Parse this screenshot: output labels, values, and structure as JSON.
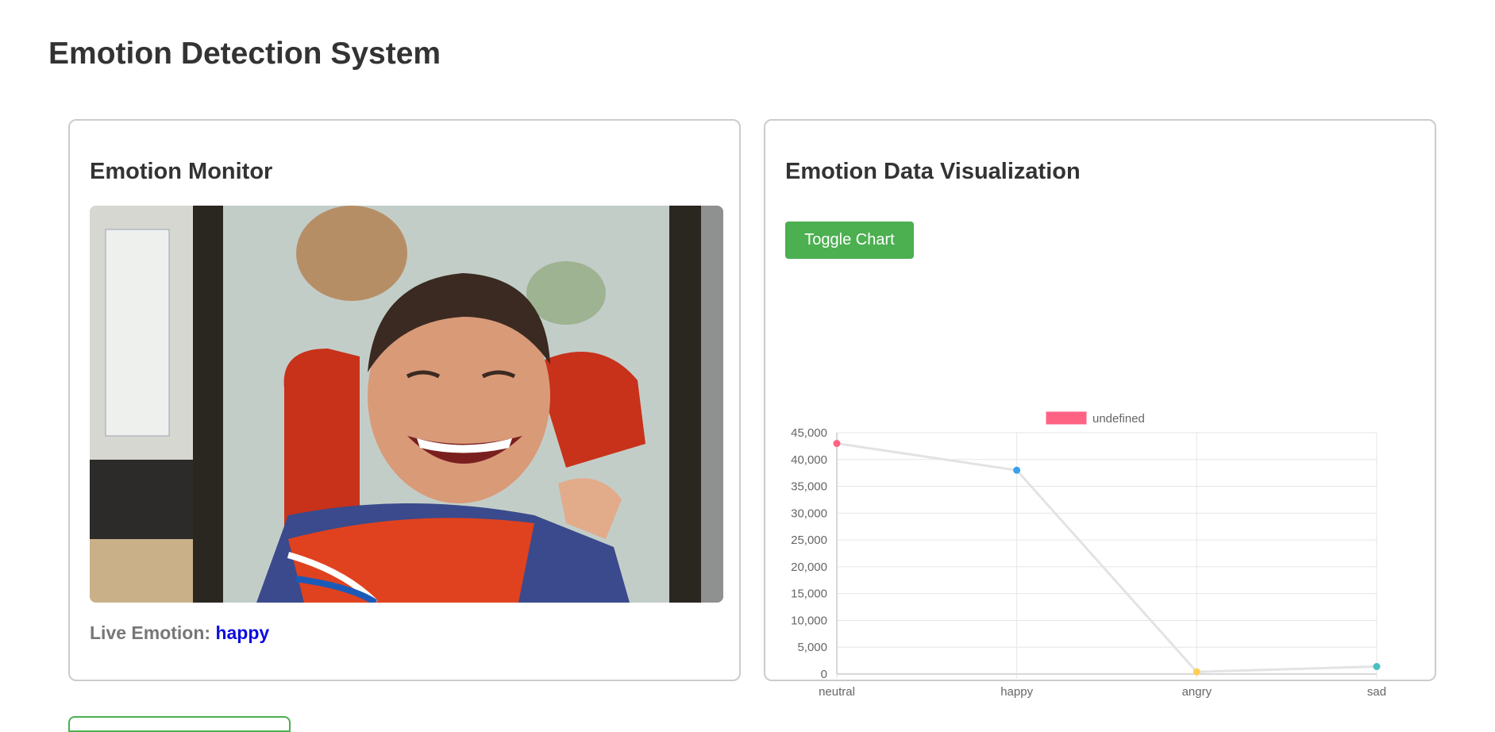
{
  "page": {
    "title": "Emotion Detection System"
  },
  "monitor": {
    "title": "Emotion Monitor",
    "live_label": "Live Emotion:",
    "live_value": "happy"
  },
  "visualization": {
    "title": "Emotion Data Visualization",
    "toggle_label": "Toggle Chart"
  },
  "colors": {
    "accent_green": "#4caf50",
    "live_value_blue": "#0b0be0",
    "legend_red": "#ff6384"
  },
  "chart_data": {
    "type": "line",
    "categories": [
      "neutral",
      "happy",
      "angry",
      "sad"
    ],
    "series": [
      {
        "name": "undefined",
        "values": [
          43000,
          38000,
          400,
          1400
        ]
      }
    ],
    "point_colors": [
      "#ff6384",
      "#36a2eb",
      "#ffce56",
      "#4bc0c0"
    ],
    "ylim": [
      0,
      45000
    ],
    "yticks": [
      0,
      5000,
      10000,
      15000,
      20000,
      25000,
      30000,
      35000,
      40000,
      45000
    ],
    "ytick_labels": [
      "0",
      "5,000",
      "10,000",
      "15,000",
      "20,000",
      "25,000",
      "30,000",
      "35,000",
      "40,000",
      "45,000"
    ],
    "grid": true,
    "legend": "top-center"
  }
}
